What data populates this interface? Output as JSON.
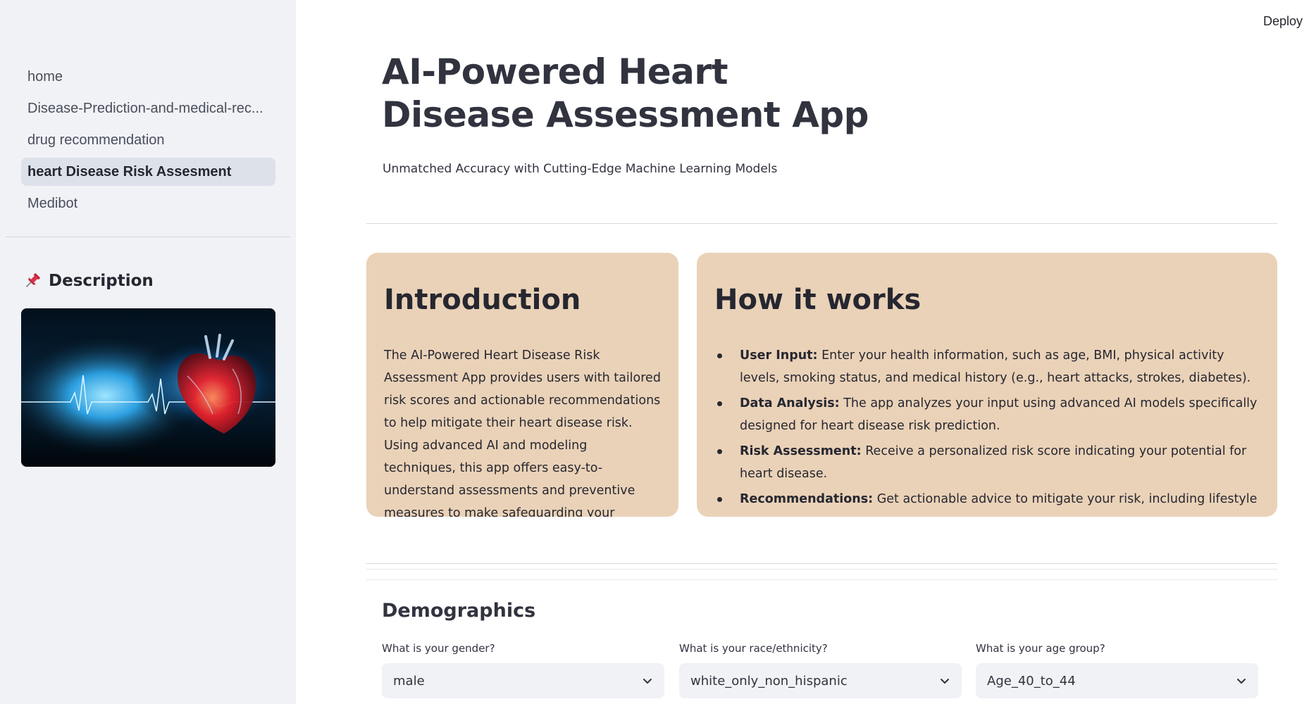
{
  "sidebar": {
    "nav": [
      {
        "label": "home"
      },
      {
        "label": "Disease-Prediction-and-medical-rec..."
      },
      {
        "label": "drug recommendation"
      },
      {
        "label": "heart Disease Risk Assesment"
      },
      {
        "label": "Medibot"
      }
    ],
    "active_index": 3,
    "description_heading": "Description",
    "description_icon": "pushpin-icon",
    "image_icon": "heart-ecg-image"
  },
  "header": {
    "deploy_label": "Deploy"
  },
  "main": {
    "title": "AI-Powered Heart Disease Assessment App",
    "subtitle": "Unmatched Accuracy with Cutting-Edge Machine Learning Models",
    "intro": {
      "heading": "Introduction",
      "text": "The AI-Powered Heart Disease Risk Assessment App provides users with tailored risk scores and actionable recommendations to help mitigate their heart disease risk. Using advanced AI and modeling techniques, this app offers easy-to-understand assessments and preventive measures to make safeguarding your cardiovascular health"
    },
    "how": {
      "heading": "How it works",
      "items": [
        {
          "term": "User Input:",
          "text": " Enter your health information, such as age, BMI, physical activity levels, smoking status, and medical history (e.g., heart attacks, strokes, diabetes)."
        },
        {
          "term": "Data Analysis:",
          "text": " The app analyzes your input using advanced AI models specifically designed for heart disease risk prediction."
        },
        {
          "term": "Risk Assessment:",
          "text": " Receive a personalized risk score indicating your potential for heart disease."
        },
        {
          "term": "Recommendations:",
          "text": " Get actionable advice to mitigate your risk, including lifestyle"
        }
      ]
    },
    "demographics": {
      "heading": "Demographics",
      "fields": [
        {
          "label": "What is your gender?",
          "value": "male"
        },
        {
          "label": "What is your race/ethnicity?",
          "value": "white_only_non_hispanic"
        },
        {
          "label": "What is your age group?",
          "value": "Age_40_to_44"
        }
      ]
    }
  },
  "colors": {
    "sidebar_bg": "#f0f2f6",
    "card_bg": "#ead2b8",
    "text": "#31333f",
    "active_nav_bg": "#dde1ea"
  }
}
